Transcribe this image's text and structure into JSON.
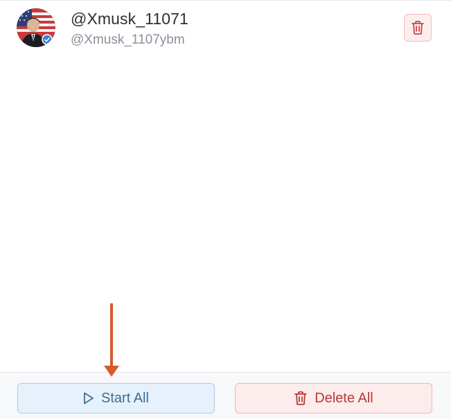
{
  "account": {
    "display_name": "@Xmusk_11071",
    "handle": "@Xmusk_1107ybm",
    "avatar_icon": "profile-photo",
    "delete_icon": "trash-icon"
  },
  "actions": {
    "start_all_label": "Start All",
    "delete_all_label": "Delete All",
    "start_icon": "play-icon",
    "delete_icon": "trash-icon"
  },
  "annotation": {
    "arrow_color": "#d65a2a",
    "arrow_icon": "arrow-down-icon"
  },
  "colors": {
    "start_button_bg": "#e6f1fb",
    "start_button_text": "#3d6d96",
    "delete_button_bg": "#fdecec",
    "delete_button_text": "#b83838"
  }
}
